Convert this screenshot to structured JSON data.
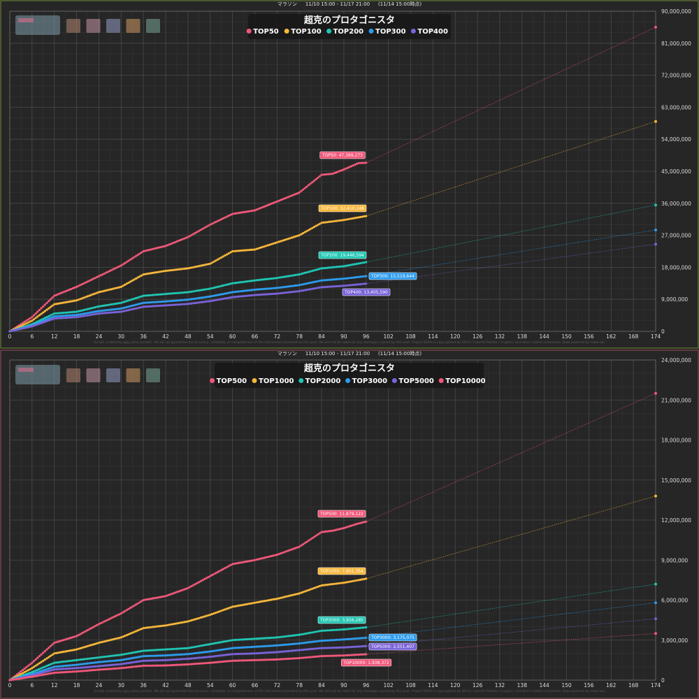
{
  "chart_data": [
    {
      "type": "line",
      "header": {
        "event_type": "マラソン",
        "period": "11/10 15:00 - 11/17 21:00",
        "as_of": "(11/14 15:00時点)"
      },
      "title": "超克のプロタゴニスタ",
      "xlim": [
        0,
        174
      ],
      "ylim": [
        0,
        90000000
      ],
      "x_ticks": [
        "0",
        "6",
        "12",
        "18",
        "24",
        "30",
        "36",
        "42",
        "48",
        "54",
        "60",
        "66",
        "72",
        "78",
        "84",
        "90",
        "96",
        "102",
        "108",
        "114",
        "120",
        "126",
        "132",
        "138",
        "144",
        "150",
        "156",
        "162",
        "168",
        "174"
      ],
      "y_ticks": [
        "0",
        "9,000,000",
        "18,000,000",
        "27,000,000",
        "36,000,000",
        "45,000,000",
        "54,000,000",
        "63,000,000",
        "72,000,000",
        "81,000,000",
        "90,000,000"
      ],
      "grid": true,
      "legend_position": "top-center",
      "footer": "(Graph created by @pj_sekai_border). We do not guarantee the accuracy, reliability, or completeness of the information provided by this post. We will not be liable for any damages caused by this post. Project SEKAI is copyrighted by SEGA / Colorful Palette / Crypton, and other related companies. Data powered by sekai-api.",
      "series": [
        {
          "name": "TOP50",
          "color": "#f0587a",
          "label": "TOP50: 47,369,273",
          "x": [
            0,
            6,
            12,
            18,
            24,
            30,
            36,
            42,
            48,
            54,
            60,
            66,
            72,
            78,
            84,
            87,
            90,
            94,
            96
          ],
          "values": [
            0,
            4000000,
            10000000,
            12500000,
            15500000,
            18500000,
            22500000,
            24000000,
            26500000,
            30000000,
            33000000,
            34000000,
            36500000,
            39000000,
            44000000,
            44300000,
            45500000,
            47300000,
            47369273
          ],
          "projection": [
            96,
            47369273,
            174,
            85500000
          ]
        },
        {
          "name": "TOP100",
          "color": "#f7b73a",
          "label": "TOP100: 32,410,148",
          "x": [
            0,
            6,
            12,
            18,
            24,
            30,
            36,
            42,
            48,
            54,
            60,
            66,
            72,
            78,
            84,
            90,
            96
          ],
          "values": [
            0,
            3000000,
            7600000,
            8700000,
            11000000,
            12500000,
            16000000,
            17000000,
            17700000,
            19000000,
            22500000,
            23000000,
            25000000,
            27000000,
            30500000,
            31300000,
            32410148
          ],
          "projection": [
            96,
            32410148,
            174,
            59000000
          ]
        },
        {
          "name": "TOP200",
          "color": "#1fc6b3",
          "label": "TOP200: 19,446,594",
          "x": [
            0,
            6,
            12,
            18,
            24,
            30,
            36,
            42,
            48,
            54,
            60,
            66,
            72,
            78,
            84,
            90,
            96
          ],
          "values": [
            0,
            2000000,
            5000000,
            5500000,
            7000000,
            8000000,
            10000000,
            10500000,
            11000000,
            12000000,
            13500000,
            14300000,
            15000000,
            16000000,
            17700000,
            18300000,
            19446594
          ],
          "projection": [
            96,
            19446594,
            174,
            35500000
          ]
        },
        {
          "name": "TOP300",
          "color": "#2d9cee",
          "label": "TOP300: 15,519,644",
          "x": [
            0,
            6,
            12,
            18,
            24,
            30,
            36,
            42,
            48,
            54,
            60,
            66,
            72,
            78,
            84,
            90,
            96
          ],
          "values": [
            0,
            1600000,
            4200000,
            4600000,
            5700000,
            6400000,
            8000000,
            8400000,
            8900000,
            9800000,
            11000000,
            11700000,
            12200000,
            13000000,
            14300000,
            14800000,
            15519644
          ],
          "projection": [
            96,
            15519644,
            174,
            28500000
          ]
        },
        {
          "name": "TOP400",
          "color": "#7a63d8",
          "label": "TOP400: 13,405,590",
          "x": [
            0,
            6,
            12,
            18,
            24,
            30,
            36,
            42,
            48,
            54,
            60,
            66,
            72,
            78,
            84,
            90,
            96
          ],
          "values": [
            0,
            1400000,
            3600000,
            4000000,
            5000000,
            5500000,
            6900000,
            7300000,
            7700000,
            8500000,
            9600000,
            10200000,
            10600000,
            11300000,
            12400000,
            12800000,
            13405590
          ],
          "projection": [
            96,
            13405590,
            174,
            24500000
          ]
        }
      ]
    },
    {
      "type": "line",
      "header": {
        "event_type": "マラソン",
        "period": "11/10 15:00 - 11/17 21:00",
        "as_of": "(11/14 15:00時点)"
      },
      "title": "超克のプロタゴニスタ",
      "xlim": [
        0,
        174
      ],
      "ylim": [
        0,
        24000000
      ],
      "x_ticks": [
        "0",
        "6",
        "12",
        "18",
        "24",
        "30",
        "36",
        "42",
        "48",
        "54",
        "60",
        "66",
        "72",
        "78",
        "84",
        "90",
        "96",
        "102",
        "108",
        "114",
        "120",
        "126",
        "132",
        "138",
        "144",
        "150",
        "156",
        "162",
        "168",
        "174"
      ],
      "y_ticks": [
        "0",
        "3,000,000",
        "6,000,000",
        "9,000,000",
        "12,000,000",
        "15,000,000",
        "18,000,000",
        "21,000,000",
        "24,000,000"
      ],
      "grid": true,
      "legend_position": "top-center",
      "footer": "(Graph created by @pj_sekai_border). We do not guarantee the accuracy, reliability, or completeness of the information provided by this post. We will not be liable for any damages caused by this post. Project SEKAI is copyrighted by SEGA / Colorful Palette / Crypton, and other related companies. Data powered by sekai-api.",
      "series": [
        {
          "name": "TOP500",
          "color": "#f0587a",
          "label": "TOP500: 11,879,122",
          "x": [
            0,
            6,
            12,
            18,
            24,
            30,
            36,
            42,
            48,
            54,
            60,
            66,
            72,
            78,
            84,
            87,
            90,
            94,
            96
          ],
          "values": [
            0,
            1300000,
            2800000,
            3300000,
            4200000,
            5000000,
            6000000,
            6300000,
            6900000,
            7800000,
            8700000,
            9000000,
            9400000,
            10000000,
            11100000,
            11200000,
            11400000,
            11750000,
            11879122
          ],
          "projection": [
            96,
            11879122,
            174,
            21500000
          ]
        },
        {
          "name": "TOP1000",
          "color": "#f7b73a",
          "label": "TOP1000: 7,601,354",
          "x": [
            0,
            6,
            12,
            18,
            24,
            30,
            36,
            42,
            48,
            54,
            60,
            66,
            72,
            78,
            84,
            90,
            96
          ],
          "values": [
            0,
            900000,
            2000000,
            2300000,
            2800000,
            3200000,
            3900000,
            4100000,
            4400000,
            4900000,
            5500000,
            5800000,
            6100000,
            6500000,
            7100000,
            7300000,
            7601354
          ],
          "projection": [
            96,
            7601354,
            174,
            13800000
          ]
        },
        {
          "name": "TOP2000",
          "color": "#1fc6b3",
          "label": "TOP2000: 3,956,285",
          "x": [
            0,
            6,
            12,
            18,
            24,
            30,
            36,
            42,
            48,
            54,
            60,
            66,
            72,
            78,
            84,
            90,
            96
          ],
          "values": [
            0,
            600000,
            1300000,
            1500000,
            1700000,
            1900000,
            2200000,
            2300000,
            2400000,
            2700000,
            3000000,
            3100000,
            3200000,
            3400000,
            3700000,
            3800000,
            3956285
          ],
          "projection": [
            96,
            3956285,
            174,
            7200000
          ]
        },
        {
          "name": "TOP3000",
          "color": "#2d9cee",
          "label": "TOP3000: 3,175,075",
          "x": [
            0,
            6,
            12,
            18,
            24,
            30,
            36,
            42,
            48,
            54,
            60,
            66,
            72,
            78,
            84,
            90,
            96
          ],
          "values": [
            0,
            450000,
            1000000,
            1150000,
            1350000,
            1500000,
            1800000,
            1850000,
            1950000,
            2150000,
            2400000,
            2500000,
            2600000,
            2750000,
            2950000,
            3050000,
            3175075
          ],
          "projection": [
            96,
            3175075,
            174,
            5800000
          ]
        },
        {
          "name": "TOP5000",
          "color": "#7a63d8",
          "label": "TOP5000: 2,551,407",
          "x": [
            0,
            6,
            12,
            18,
            24,
            30,
            36,
            42,
            48,
            54,
            60,
            66,
            72,
            78,
            84,
            90,
            96
          ],
          "values": [
            0,
            350000,
            800000,
            900000,
            1050000,
            1200000,
            1450000,
            1500000,
            1600000,
            1750000,
            1950000,
            2000000,
            2100000,
            2250000,
            2400000,
            2450000,
            2551407
          ],
          "projection": [
            96,
            2551407,
            174,
            4600000
          ]
        },
        {
          "name": "TOP10000",
          "color": "#f0587a",
          "label": "TOP10000: 1,938,372",
          "x": [
            0,
            6,
            12,
            18,
            24,
            30,
            36,
            42,
            48,
            54,
            60,
            66,
            72,
            78,
            84,
            90,
            96
          ],
          "values": [
            0,
            250000,
            550000,
            650000,
            780000,
            900000,
            1080000,
            1100000,
            1180000,
            1300000,
            1450000,
            1500000,
            1550000,
            1650000,
            1800000,
            1850000,
            1938372
          ],
          "projection": [
            96,
            1938372,
            174,
            3500000
          ]
        }
      ]
    }
  ]
}
